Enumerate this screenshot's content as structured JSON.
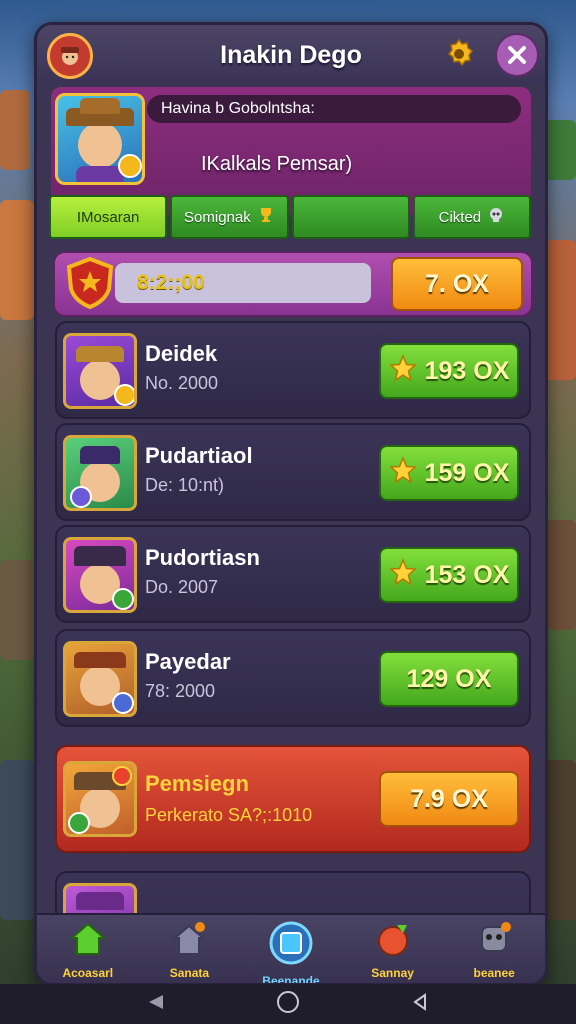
{
  "window": {
    "title": "Inakin Dego"
  },
  "profile": {
    "status_text": "Havina b Gobolntsha:",
    "player_name": "IKalkals Pemsar)"
  },
  "tabs": [
    {
      "label": "IMosaran",
      "icon": "none"
    },
    {
      "label": "Somignak",
      "icon": "trophy-icon"
    },
    {
      "label": "",
      "icon": "none"
    },
    {
      "label": "Cikted",
      "icon": "skull-icon"
    }
  ],
  "score": {
    "value": "8:2:;00",
    "button_label": "7. OX"
  },
  "rows": [
    {
      "name": "Deidek",
      "sub": "No. 2000",
      "price": "193 OX",
      "has_star": true
    },
    {
      "name": "Pudartiaol",
      "sub": "De: 10:nt)",
      "price": "159 OX",
      "has_star": true
    },
    {
      "name": "Pudortiasn",
      "sub": "Do. 2007",
      "price": "153 OX",
      "has_star": true
    },
    {
      "name": "Payedar",
      "sub": "78: 2000",
      "price": "129 OX",
      "has_star": false
    },
    {
      "name": "Pemsiegn",
      "sub": "Perkerato SA?;:1010",
      "price": "7.9 OX",
      "has_star": false
    }
  ],
  "nav": [
    {
      "label": "Acoasarl",
      "icon": "home-icon"
    },
    {
      "label": "Sanata",
      "icon": "shop-icon"
    },
    {
      "label": "Beenande",
      "icon": "inventory-icon"
    },
    {
      "label": "Sannay",
      "icon": "map-icon"
    },
    {
      "label": "beanee",
      "icon": "robot-icon"
    }
  ],
  "colors": {
    "panel": "#3b3452",
    "accent_green": "#44a81d",
    "accent_orange": "#f08a12",
    "highlight_red": "#d94432",
    "gold": "#ffd23a"
  }
}
